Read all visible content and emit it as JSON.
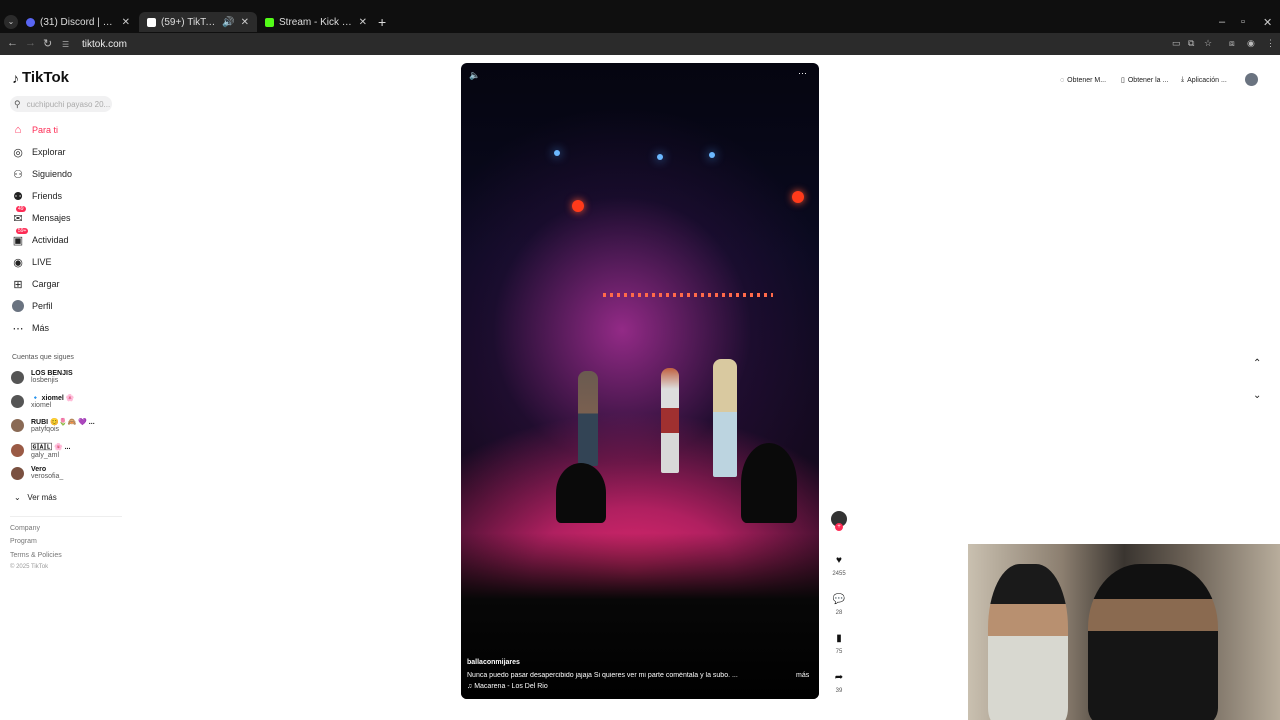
{
  "browser": {
    "tabs": [
      {
        "title": "(31) Discord | #🎬 reacciones",
        "favicon_color": "#5865f2",
        "active": false
      },
      {
        "title": "(59+) TikTok - Make Your D",
        "favicon_color": "#ffffff",
        "active": true
      },
      {
        "title": "Stream - Kick Dashboard",
        "favicon_color": "#53fc18",
        "active": false
      }
    ],
    "url": "tiktok.com"
  },
  "tiktok": {
    "brand": "TikTok",
    "search_placeholder": "cuchipuchi payaso 20...",
    "nav": [
      {
        "label": "Para ti",
        "icon": "home-icon",
        "active": true,
        "badge": ""
      },
      {
        "label": "Explorar",
        "icon": "compass-icon",
        "active": false,
        "badge": ""
      },
      {
        "label": "Siguiendo",
        "icon": "following-icon",
        "active": false,
        "badge": ""
      },
      {
        "label": "Friends",
        "icon": "friends-icon",
        "active": false,
        "badge": ""
      },
      {
        "label": "Mensajes",
        "icon": "messages-icon",
        "active": false,
        "badge": "49"
      },
      {
        "label": "Actividad",
        "icon": "activity-icon",
        "active": false,
        "badge": "59+"
      },
      {
        "label": "LIVE",
        "icon": "live-icon",
        "active": false,
        "badge": ""
      },
      {
        "label": "Cargar",
        "icon": "upload-icon",
        "active": false,
        "badge": ""
      },
      {
        "label": "Perfil",
        "icon": "profile-icon",
        "active": false,
        "badge": ""
      },
      {
        "label": "Más",
        "icon": "more-icon",
        "active": false,
        "badge": ""
      }
    ],
    "following_title": "Cuentas que sigues",
    "following": [
      {
        "name": "LOS BENJIS",
        "handle": "losbenjis"
      },
      {
        "name": "🔹 xiomel 🌸",
        "handle": "xiomel"
      },
      {
        "name": "RUBI 😊🌷🙈 💜 ...",
        "handle": "patyfqois"
      },
      {
        "name": "🄶🄰🄻 🌸 ...",
        "handle": "galy_aml"
      },
      {
        "name": "Vero",
        "handle": "verosofia_"
      }
    ],
    "see_more": "Ver más",
    "footer": [
      "Company",
      "Program",
      "Terms & Policies",
      "© 2025 TikTok"
    ],
    "top_actions": [
      "Obtener M...",
      "Obtener la ...",
      "Aplicación ..."
    ],
    "video": {
      "username": "ballaconmijares",
      "caption": "Nunca puedo pasar desapercibido jajaja   Si quieres ver mi parte coméntala y la subo. ...",
      "more": "más",
      "sound": "Macarena - Los Del Rio"
    },
    "counts": {
      "likes": "2455",
      "comments": "28",
      "saves": "75",
      "shares": "39"
    }
  }
}
